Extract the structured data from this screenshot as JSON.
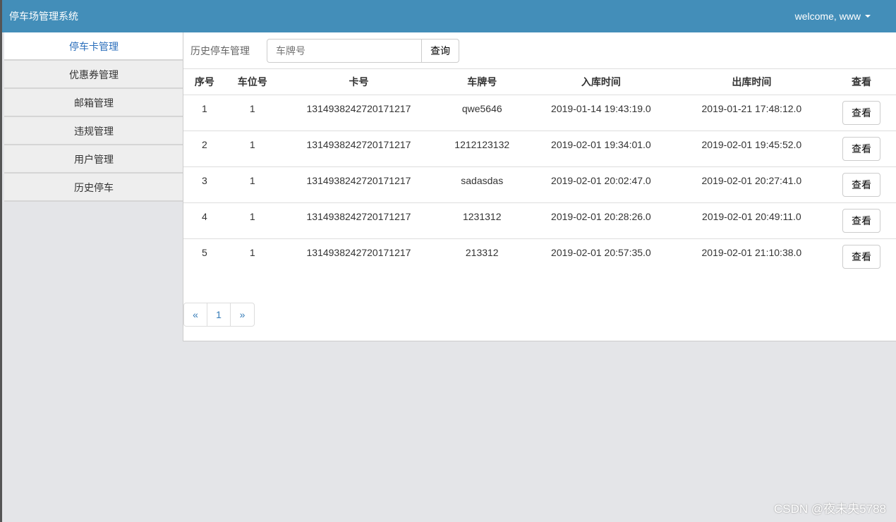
{
  "header": {
    "title": "停车场管理系统",
    "user": "welcome, www"
  },
  "sidebar": {
    "items": [
      {
        "label": "停车卡管理"
      },
      {
        "label": "优惠券管理"
      },
      {
        "label": "邮箱管理"
      },
      {
        "label": "违规管理"
      },
      {
        "label": "用户管理"
      },
      {
        "label": "历史停车"
      }
    ]
  },
  "main": {
    "title": "历史停车管理",
    "search_placeholder": "车牌号",
    "search_button": "查询",
    "columns": [
      "序号",
      "车位号",
      "卡号",
      "车牌号",
      "入库时间",
      "出库时间",
      "查看"
    ],
    "rows": [
      [
        "1",
        "1",
        "1314938242720171217",
        "qwe5646",
        "2019-01-14 19:43:19.0",
        "2019-01-21 17:48:12.0"
      ],
      [
        "2",
        "1",
        "1314938242720171217",
        "1212123132",
        "2019-02-01 19:34:01.0",
        "2019-02-01 19:45:52.0"
      ],
      [
        "3",
        "1",
        "1314938242720171217",
        "sadasdas",
        "2019-02-01 20:02:47.0",
        "2019-02-01 20:27:41.0"
      ],
      [
        "4",
        "1",
        "1314938242720171217",
        "1231312",
        "2019-02-01 20:28:26.0",
        "2019-02-01 20:49:11.0"
      ],
      [
        "5",
        "1",
        "1314938242720171217",
        "213312",
        "2019-02-01 20:57:35.0",
        "2019-02-01 21:10:38.0"
      ]
    ],
    "view_button": "查看",
    "pagination": {
      "prev": "«",
      "page": "1",
      "next": "»"
    }
  },
  "watermark": "CSDN @夜未央5788"
}
